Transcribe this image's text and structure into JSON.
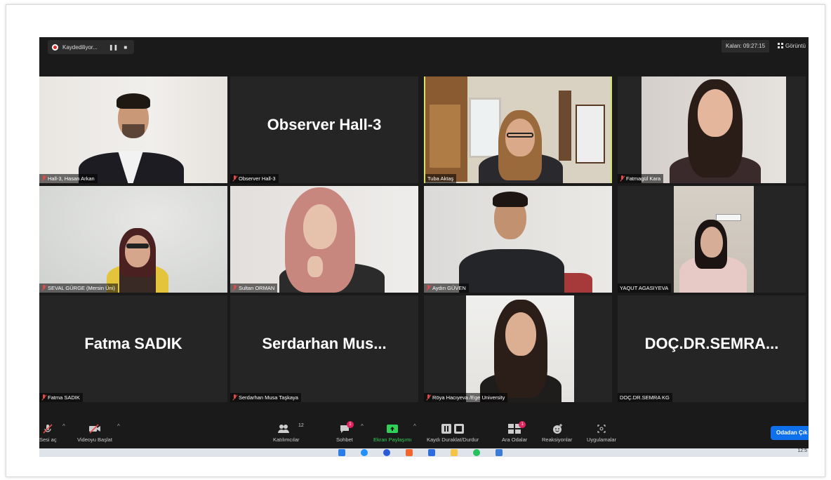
{
  "recording": {
    "label": "Kaydediliyor...",
    "pause_icon": "pause-icon",
    "stop_icon": "stop-icon"
  },
  "remaining": "Kalan: 09:27:15",
  "view_label": "Görüntü",
  "tiles": [
    {
      "name": "Hall-3, Hasan Arkan",
      "muted": true,
      "display": "video"
    },
    {
      "name": "Observer Hall-3",
      "muted": true,
      "display": "name",
      "big_name": "Observer Hall-3"
    },
    {
      "name": "Tuba Aktaş",
      "muted": false,
      "display": "video",
      "active": true
    },
    {
      "name": "Fatmagül Kara",
      "muted": true,
      "display": "video"
    },
    {
      "name": "SEVAL GÜRGE (Mersin Üni)",
      "muted": true,
      "display": "video"
    },
    {
      "name": "Sultan ORMAN",
      "muted": true,
      "display": "video"
    },
    {
      "name": "Aydın GÜVEN",
      "muted": true,
      "display": "video"
    },
    {
      "name": "YAQUT AGASIYEVA",
      "muted": false,
      "display": "video"
    },
    {
      "name": "Fatma SADIK",
      "muted": true,
      "display": "name",
      "big_name": "Fatma SADIK"
    },
    {
      "name": "Serdarhan Musa Taşkaya",
      "muted": true,
      "display": "name",
      "big_name": "Serdarhan  Mus..."
    },
    {
      "name": "Röya Hacıyeva /Ege University",
      "muted": true,
      "display": "video"
    },
    {
      "name": "DOÇ.DR.SEMRA KG",
      "muted": false,
      "display": "name",
      "big_name": "DOÇ.DR.SEMRA..."
    }
  ],
  "toolbar": {
    "unmute": "Sesi aç",
    "start_video": "Videoyu Başlat",
    "participants": "Katılımcılar",
    "participants_count": "12",
    "chat": "Sohbet",
    "chat_badge": "1",
    "share": "Ekran Paylaşımı",
    "record": "Kaydı Duraklat/Durdur",
    "breakout": "Ara Odalar",
    "breakout_badge": "1",
    "reactions": "Reaksiyonlar",
    "apps": "Uygulamalar",
    "leave": "Odadan Çık"
  },
  "taskbar": {
    "time": "12:5"
  },
  "colors": {
    "active_border": "#d8e06a",
    "leave_button": "#0e71eb",
    "share_green": "#30d158",
    "muted_red": "#e24a4a"
  }
}
